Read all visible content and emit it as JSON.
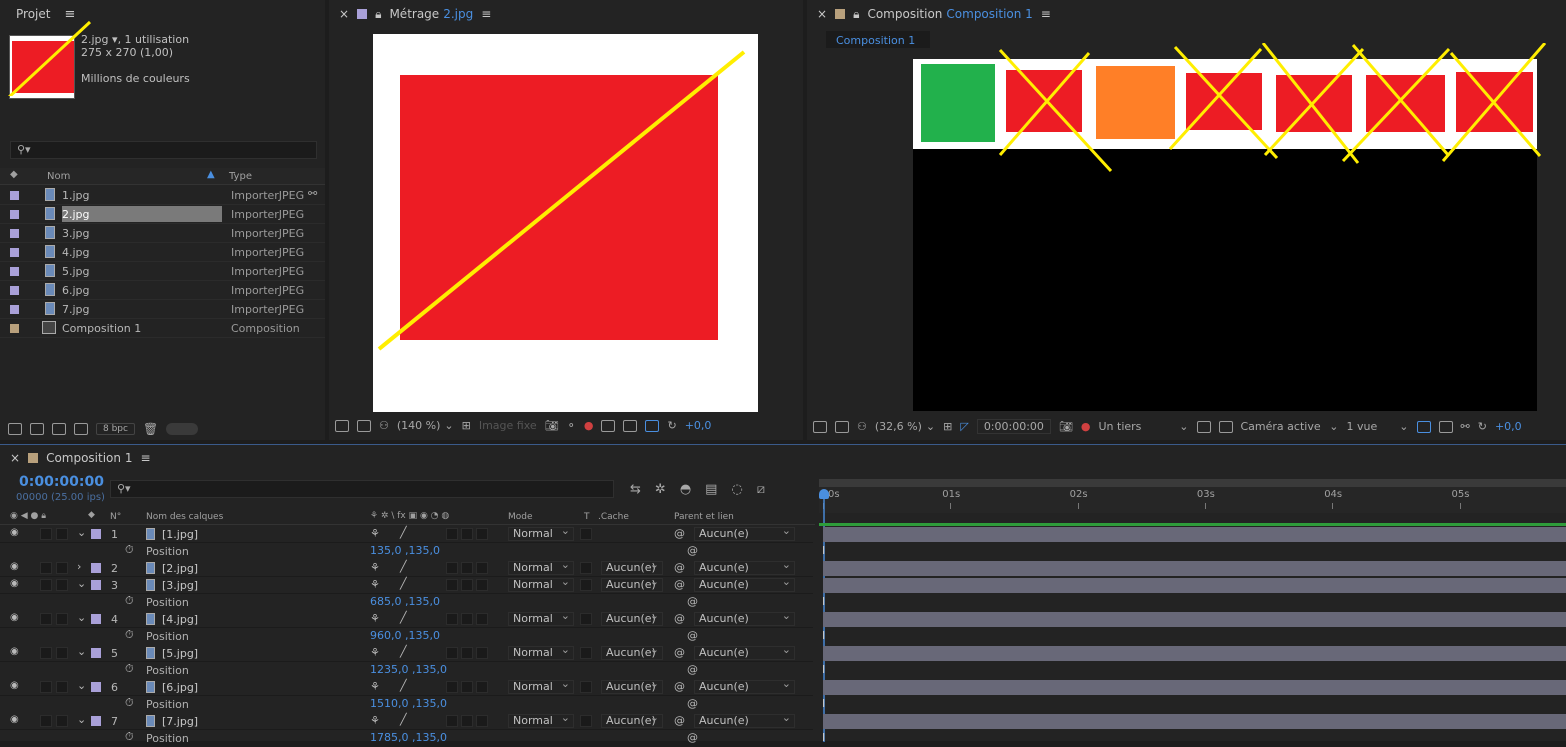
{
  "project": {
    "tab": "Projet",
    "info_name": "2.jpg",
    "info_usage": ", 1 utilisation",
    "info_dims": "275 x 270 (1,00)",
    "info_colors": "Millions de couleurs",
    "col_name": "Nom",
    "col_type": "Type",
    "items": [
      {
        "name": "1.jpg",
        "type": "ImporterJPEG"
      },
      {
        "name": "2.jpg",
        "type": "ImporterJPEG"
      },
      {
        "name": "3.jpg",
        "type": "ImporterJPEG"
      },
      {
        "name": "4.jpg",
        "type": "ImporterJPEG"
      },
      {
        "name": "5.jpg",
        "type": "ImporterJPEG"
      },
      {
        "name": "6.jpg",
        "type": "ImporterJPEG"
      },
      {
        "name": "7.jpg",
        "type": "ImporterJPEG"
      },
      {
        "name": "Composition 1",
        "type": "Composition"
      }
    ],
    "bpc": "8 bpc"
  },
  "footage": {
    "tab_prefix": "Métrage",
    "tab_name": "2.jpg",
    "zoom": "(140 %)",
    "still": "Image fixe",
    "exposure": "+0,0"
  },
  "comp_viewer": {
    "tab_prefix": "Composition",
    "tab_name": "Composition 1",
    "subtab": "Composition 1",
    "zoom": "(32,6 %)",
    "timecode": "0:00:00:00",
    "resolution": "Un tiers",
    "camera": "Caméra active",
    "views": "1 vue",
    "exposure": "+0,0"
  },
  "timeline": {
    "tab": "Composition 1",
    "timecode": "0:00:00:00",
    "frames": "00000 (25.00 ips)",
    "col_num": "N°",
    "col_name": "Nom des calques",
    "col_mode": "Mode",
    "col_t": "T",
    "col_cache": ".Cache",
    "col_parent": "Parent et lien",
    "ruler": [
      "0s",
      "01s",
      "02s",
      "03s",
      "04s",
      "05s"
    ],
    "layers": [
      {
        "num": "1",
        "name": "[1.jpg]",
        "mode": "Normal",
        "cache": "",
        "parent": "Aucun(e)",
        "expanded": true,
        "position": "135,0 ,135,0"
      },
      {
        "num": "2",
        "name": "[2.jpg]",
        "mode": "Normal",
        "cache": "Aucun(e)",
        "parent": "Aucun(e)",
        "expanded": false,
        "position": ""
      },
      {
        "num": "3",
        "name": "[3.jpg]",
        "mode": "Normal",
        "cache": "Aucun(e)",
        "parent": "Aucun(e)",
        "expanded": true,
        "position": "685,0 ,135,0"
      },
      {
        "num": "4",
        "name": "[4.jpg]",
        "mode": "Normal",
        "cache": "Aucun(e)",
        "parent": "Aucun(e)",
        "expanded": true,
        "position": "960,0 ,135,0"
      },
      {
        "num": "5",
        "name": "[5.jpg]",
        "mode": "Normal",
        "cache": "Aucun(e)",
        "parent": "Aucun(e)",
        "expanded": true,
        "position": "1235,0 ,135,0"
      },
      {
        "num": "6",
        "name": "[6.jpg]",
        "mode": "Normal",
        "cache": "Aucun(e)",
        "parent": "Aucun(e)",
        "expanded": true,
        "position": "1510,0 ,135,0"
      },
      {
        "num": "7",
        "name": "[7.jpg]",
        "mode": "Normal",
        "cache": "Aucun(e)",
        "parent": "Aucun(e)",
        "expanded": true,
        "position": "1785,0 ,135,0"
      }
    ],
    "position_label": "Position"
  },
  "colors": {
    "accent": "#4a8fe0",
    "red": "#ed1c24",
    "green": "#22b14c",
    "orange": "#ff7f27",
    "yellow": "#ffee00",
    "layer_label": "#a9a0d8",
    "comp_label": "#b8a07c"
  }
}
